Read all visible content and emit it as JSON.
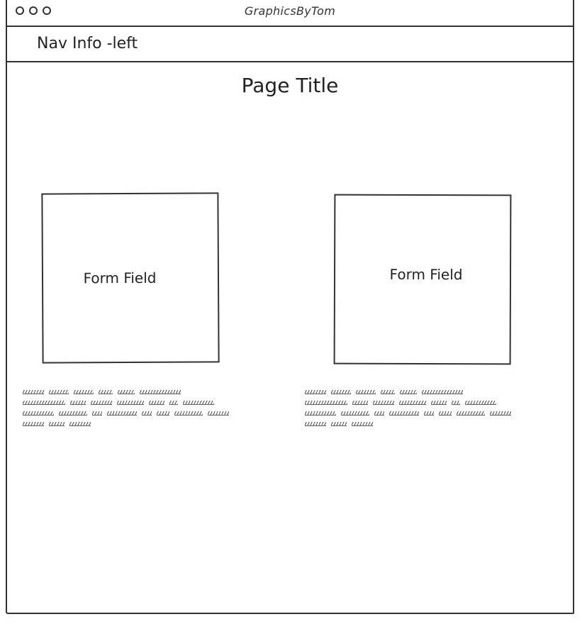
{
  "window": {
    "title": "GraphicsByTom",
    "controls": [
      "circle-icon",
      "circle-icon",
      "circle-icon"
    ]
  },
  "nav": {
    "info": "Nav Info -left"
  },
  "page": {
    "title": "Page Title"
  },
  "form_fields": [
    {
      "label": "Form Field"
    },
    {
      "label": "Form Field"
    }
  ],
  "colors": {
    "stroke": "#333333",
    "background": "#ffffff"
  }
}
